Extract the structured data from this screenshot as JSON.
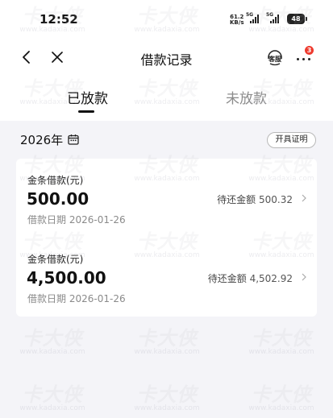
{
  "status_bar": {
    "time": "12:52",
    "net_speed_value": "61.2",
    "net_speed_unit": "KB/s",
    "signal_1_label": "5G",
    "signal_2_label": "5G",
    "battery": "48"
  },
  "nav": {
    "title": "借款记录",
    "service_label": "客服",
    "more_badge": "3"
  },
  "tabs": [
    {
      "label": "已放款",
      "active": true
    },
    {
      "label": "未放款",
      "active": false
    }
  ],
  "year_row": {
    "year": "2026年",
    "certificate_button": "开具证明"
  },
  "loans": [
    {
      "type_label": "金条借款(元)",
      "amount": "500.00",
      "date_label": "借款日期",
      "date": "2026-01-26",
      "due_label": "待还金额",
      "due_amount": "500.32"
    },
    {
      "type_label": "金条借款(元)",
      "amount": "4,500.00",
      "date_label": "借款日期",
      "date": "2026-01-26",
      "due_label": "待还金额",
      "due_amount": "4,502.92"
    }
  ],
  "watermark": {
    "text": "卡大侠",
    "url": "www.kadaxia.com"
  },
  "colors": {
    "background": "#f4f4f8",
    "card": "#ffffff",
    "badge": "#ee3b2f",
    "inactive_tab": "#8b8b8b"
  }
}
